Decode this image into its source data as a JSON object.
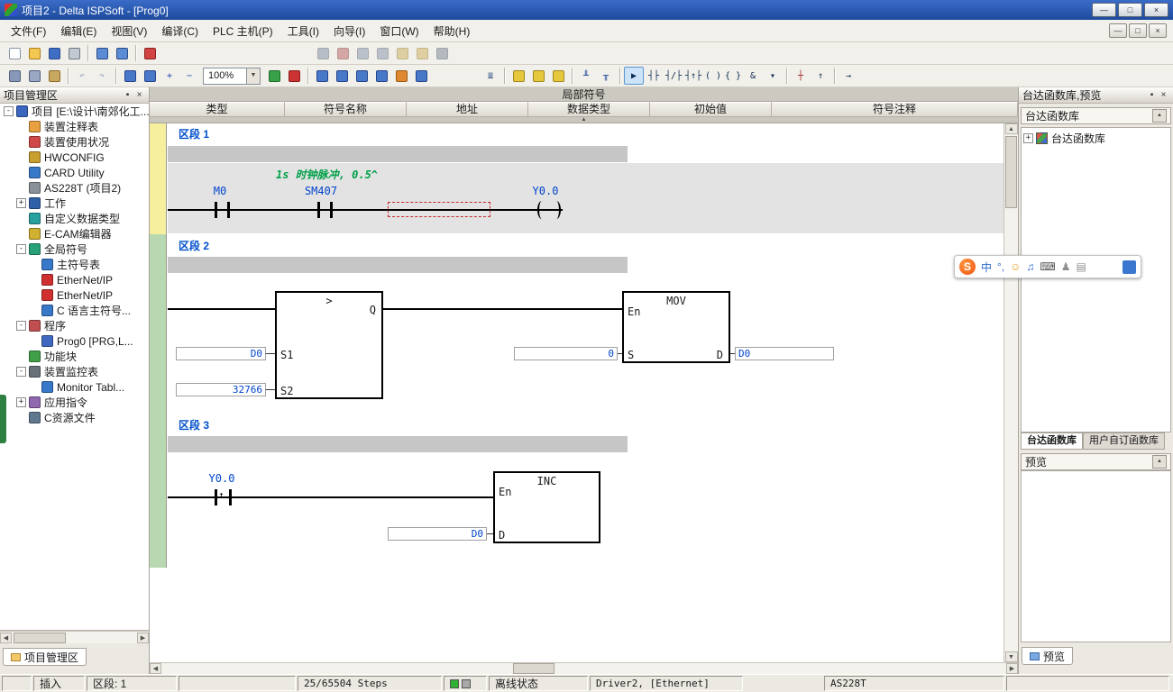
{
  "window": {
    "title": "项目2 - Delta ISPSoft - [Prog0]"
  },
  "icons": {
    "min": "—",
    "max": "□",
    "close": "×",
    "pin": "▪",
    "up": "▲",
    "down": "▼",
    "left": "◀",
    "right": "▶",
    "collapse": "▲",
    "rising": "↑"
  },
  "menu_bar": {
    "items": [
      "文件(F)",
      "编辑(E)",
      "视图(V)",
      "编译(C)",
      "PLC 主机(P)",
      "工具(I)",
      "向导(I)",
      "窗口(W)",
      "帮助(H)"
    ]
  },
  "toolbars": {
    "zoom_value": "100%",
    "row1_main": [
      {
        "n": "new-file-button",
        "bg": "#fefefe",
        "bd": "#8494a8"
      },
      {
        "n": "open-project-button",
        "bg": "#f4c752",
        "bd": "#a87c20"
      },
      {
        "n": "save-button",
        "bg": "#3f6fc4",
        "bd": "#27498c"
      },
      {
        "n": "print-button",
        "bg": "#c3c9d3",
        "bd": "#6d7684"
      },
      {
        "sep": true
      },
      {
        "n": "project-workspace-button",
        "bg": "#5b8bd4",
        "bd": "#2a4a88"
      },
      {
        "n": "output-window-button",
        "bg": "#5b8bd4",
        "bd": "#2a4a88"
      },
      {
        "sep": true
      },
      {
        "n": "compile-button",
        "bg": "#d24444",
        "bd": "#8c2020"
      }
    ],
    "row1_aux": [
      {
        "n": "window-layout-button",
        "bg": "#70809c",
        "bd": "#4a5468",
        "dis": true
      },
      {
        "n": "record-button",
        "bg": "#b05050",
        "bd": "#702828",
        "dis": true
      },
      {
        "n": "rotate-left-button",
        "bg": "#7a8aa6",
        "bd": "#4a5468",
        "dis": true
      },
      {
        "n": "rotate-right-button",
        "bg": "#7a8aa6",
        "bd": "#4a5468",
        "dis": true
      },
      {
        "n": "lock-button",
        "bg": "#c8a648",
        "bd": "#8c7020",
        "dis": true
      },
      {
        "n": "unlock-button",
        "bg": "#c8a648",
        "bd": "#8c7020",
        "dis": true
      },
      {
        "n": "anchor-button",
        "bg": "#68788a",
        "bd": "#3a4a5c",
        "dis": true
      }
    ],
    "row2_clipboard": [
      {
        "n": "cut-button",
        "bg": "#8898b8",
        "bd": "#54607c"
      },
      {
        "n": "copy-button",
        "bg": "#9aa8c4",
        "bd": "#54607c"
      },
      {
        "n": "paste-button",
        "bg": "#c8a860",
        "bd": "#8c6c24"
      },
      {
        "sep": true
      },
      {
        "n": "undo-button",
        "g": "↶",
        "fg": "#204880",
        "dis": true
      },
      {
        "n": "redo-button",
        "g": "↷",
        "fg": "#204880",
        "dis": true
      },
      {
        "sep": true
      }
    ],
    "row2_zoom": [
      {
        "n": "find-button",
        "bg": "#4878c8",
        "bd": "#24448c"
      },
      {
        "n": "find-replace-button",
        "bg": "#4878c8",
        "bd": "#24448c"
      },
      {
        "n": "zoom-in-button",
        "g": "+",
        "fg": "#1a4ab0"
      },
      {
        "n": "zoom-out-button",
        "g": "−",
        "fg": "#1a4ab0"
      }
    ],
    "row2_plc": [
      {
        "n": "simulator-button",
        "bg": "#38a048",
        "bd": "#1c6c28"
      },
      {
        "n": "stop-simulator-button",
        "bg": "#cc3434",
        "bd": "#8c1c1c"
      },
      {
        "sep": true
      },
      {
        "n": "download-button",
        "bg": "#4878c8",
        "bd": "#24448c"
      },
      {
        "n": "upload-button",
        "bg": "#4878c8",
        "bd": "#24448c"
      },
      {
        "n": "monitor-button",
        "bg": "#4878c8",
        "bd": "#24448c"
      },
      {
        "n": "device-monitor-button",
        "bg": "#4878c8",
        "bd": "#24448c"
      },
      {
        "n": "online-edit-button",
        "bg": "#e08830",
        "bd": "#9c5c14"
      },
      {
        "n": "memory-button",
        "bg": "#4878c8",
        "bd": "#24448c"
      }
    ],
    "row2_tools": [
      {
        "n": "instruction-wizard-button",
        "g": "≣",
        "fg": "#204880"
      },
      {
        "sep": true
      },
      {
        "n": "add-network-button",
        "bg": "#e6c83c",
        "bd": "#a08820"
      },
      {
        "n": "add-network-below-button",
        "bg": "#e6c83c",
        "bd": "#a08820"
      },
      {
        "n": "network-list-button",
        "bg": "#e6c83c",
        "bd": "#a08820"
      },
      {
        "sep": true
      },
      {
        "n": "ladder-up-button",
        "g": "╨",
        "fg": "#1c4a9c"
      },
      {
        "n": "ladder-down-button",
        "g": "╥",
        "fg": "#1c4a9c"
      },
      {
        "sep": true
      },
      {
        "n": "select-tool-button",
        "g": "▶",
        "fg": "#0c2c54",
        "sel": true
      },
      {
        "n": "contact-no-button",
        "g": "┤├",
        "fg": "#0c2c54"
      },
      {
        "n": "contact-nc-button",
        "g": "┤/├",
        "fg": "#0c2c54"
      },
      {
        "n": "edge-contact-button",
        "g": "┤↑├",
        "fg": "#0c2c54"
      },
      {
        "n": "coil-button",
        "g": "( )",
        "fg": "#0c2c54"
      },
      {
        "n": "applied-instruction-button",
        "g": "{ }",
        "fg": "#0c2c54"
      },
      {
        "n": "function-block-button",
        "g": "&",
        "fg": "#0c2c54"
      },
      {
        "n": "more-elements-button",
        "g": "▾",
        "fg": "#0c2c54"
      },
      {
        "sep": true
      },
      {
        "n": "vertical-line-button",
        "g": "┼",
        "fg": "#9c2020"
      },
      {
        "n": "rising-pulse-button",
        "g": "↑",
        "fg": "#0c2c54"
      },
      {
        "sep": true
      },
      {
        "n": "goto-button",
        "g": "→",
        "fg": "#0c2c54"
      }
    ]
  },
  "project_panel": {
    "title": "项目管理区",
    "bottom_tab": "项目管理区"
  },
  "project_tree": [
    {
      "label": "项目 [E:\\设计\\南郊化工...",
      "lvl": 0,
      "exp": "-",
      "c": "#3a66c0"
    },
    {
      "label": "装置注释表",
      "lvl": 1,
      "c": "#e8a040"
    },
    {
      "label": "装置使用状况",
      "lvl": 1,
      "c": "#d04848"
    },
    {
      "label": "HWCONFIG",
      "lvl": 1,
      "c": "#c8a030"
    },
    {
      "label": "CARD Utility",
      "lvl": 1,
      "c": "#3878c8"
    },
    {
      "label": "AS228T (项目2)",
      "lvl": 1,
      "c": "#8a9098"
    },
    {
      "label": "工作",
      "lvl": 1,
      "exp": "+",
      "c": "#3060a8"
    },
    {
      "label": "自定义数据类型",
      "lvl": 1,
      "c": "#28a0a0"
    },
    {
      "label": "E-CAM编辑器",
      "lvl": 1,
      "c": "#d0b030"
    },
    {
      "label": "全局符号",
      "lvl": 1,
      "exp": "-",
      "c": "#28a078"
    },
    {
      "label": "主符号表",
      "lvl": 2,
      "c": "#3878c8"
    },
    {
      "label": "EtherNet/IP",
      "lvl": 2,
      "c": "#d03030"
    },
    {
      "label": "EtherNet/IP",
      "lvl": 2,
      "c": "#d03030"
    },
    {
      "label": "C 语言主符号...",
      "lvl": 2,
      "c": "#3878c8"
    },
    {
      "label": "程序",
      "lvl": 1,
      "exp": "-",
      "c": "#c05050"
    },
    {
      "label": "Prog0 [PRG,L...",
      "lvl": 2,
      "c": "#4068c0"
    },
    {
      "label": "功能块",
      "lvl": 1,
      "c": "#40a048"
    },
    {
      "label": "装置监控表",
      "lvl": 1,
      "exp": "-",
      "c": "#687078"
    },
    {
      "label": "Monitor Tabl...",
      "lvl": 2,
      "c": "#3878c8"
    },
    {
      "label": "应用指令",
      "lvl": 1,
      "exp": "+",
      "c": "#9068b0"
    },
    {
      "label": "C资源文件",
      "lvl": 1,
      "c": "#607890"
    }
  ],
  "editor": {
    "symbols_title": "局部符号",
    "columns": [
      "类型",
      "符号名称",
      "地址",
      "数据类型",
      "初始值",
      "符号注释"
    ],
    "s1": {
      "label": "区段 1",
      "comment": "1s 时钟脉冲, 0.5^",
      "c1": "M0",
      "c2": "SM407",
      "coil": "Y0.0"
    },
    "s2": {
      "label": "区段 2",
      "op": ">",
      "q": "Q",
      "p1": "S1",
      "p1v": "D0",
      "p2": "S2",
      "p2v": "32766",
      "mov": "MOV",
      "en": "En",
      "s": "S",
      "sv": "0",
      "d": "D",
      "dv": "D0"
    },
    "s3": {
      "label": "区段 3",
      "c1": "Y0.0",
      "inc": "INC",
      "en": "En",
      "d": "D",
      "dv": "D0"
    }
  },
  "library_panel": {
    "header": "台达函数库,预览",
    "group_header": "台达函数库",
    "tree_root": "台达函数库",
    "tabs": [
      {
        "label": "台达函数库",
        "active": true
      },
      {
        "label": "用户自订函数库",
        "active": false
      }
    ],
    "preview_header": "预览",
    "bottom_tab": "预览"
  },
  "status_bar": {
    "mode": "插入",
    "section": "区段: 1",
    "steps": "25/65504 Steps",
    "conn_status": "离线状态",
    "driver": "Driver2, [Ethernet]",
    "device": "AS228T"
  },
  "ime_bar": {
    "logo": "S",
    "icons": [
      {
        "n": "chinese-mode-icon",
        "g": "中",
        "c": "#2a6ad0"
      },
      {
        "n": "punctuation-icon",
        "g": "°,",
        "c": "#2a6ad0"
      },
      {
        "n": "emoji-icon",
        "g": "☺",
        "c": "#e0a020"
      },
      {
        "n": "voice-icon",
        "g": "♫",
        "c": "#2a6ad0"
      },
      {
        "n": "keyboard-icon",
        "g": "⌨",
        "c": "#505050"
      },
      {
        "n": "account-icon",
        "g": "♟",
        "c": "#909090"
      },
      {
        "n": "skin-icon",
        "g": "▤",
        "c": "#909090"
      }
    ]
  }
}
